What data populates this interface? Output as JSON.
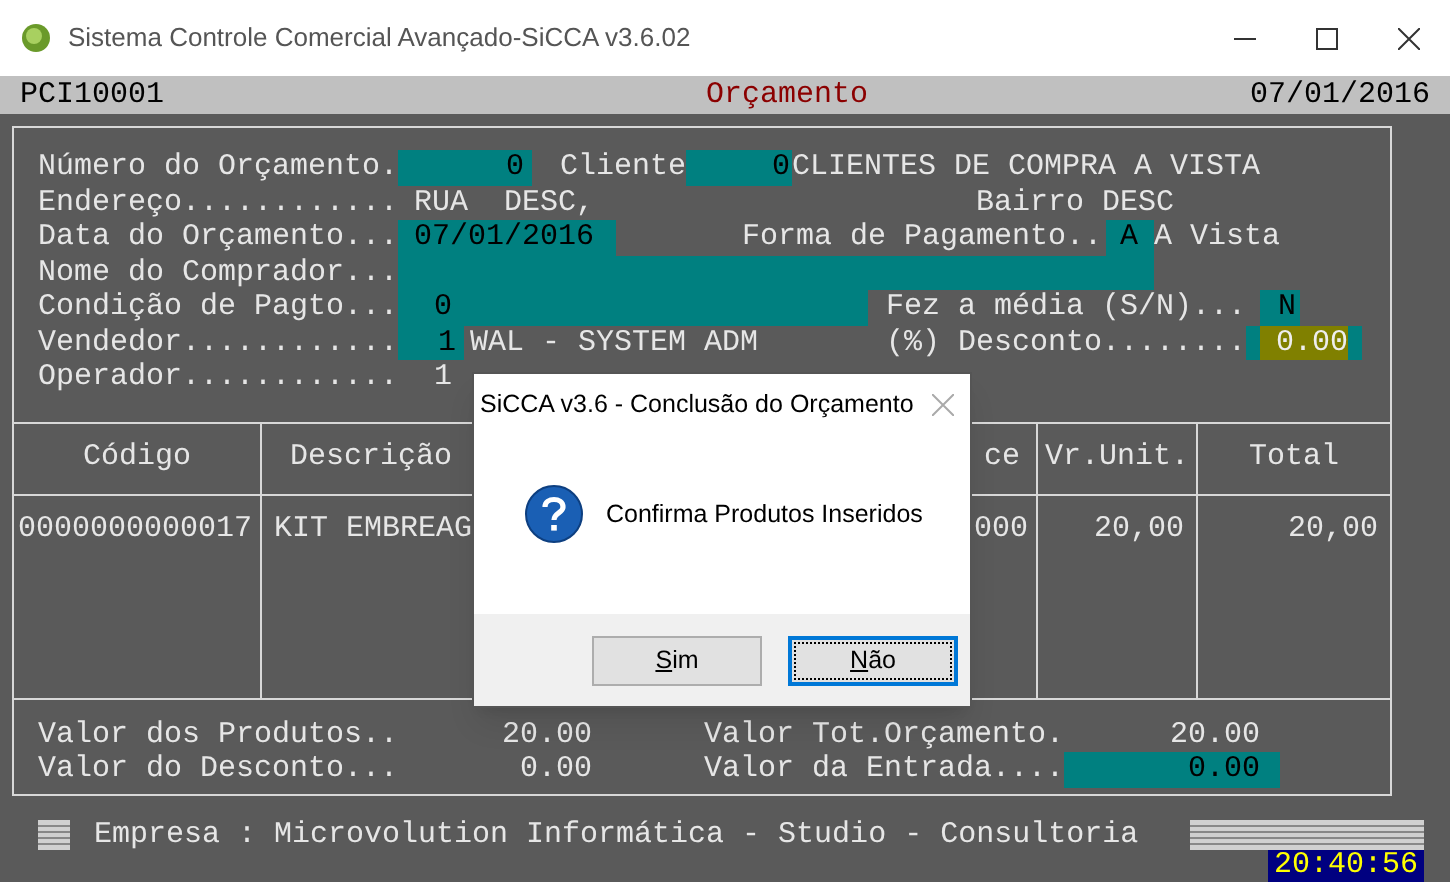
{
  "window": {
    "title": "Sistema Controle Comercial Avançado-SiCCA v3.6.02"
  },
  "header": {
    "code": "PCI10001",
    "title": "Orçamento",
    "date": "07/01/2016"
  },
  "form": {
    "numero": {
      "label": "Número do Orçamento.",
      "value": "0"
    },
    "cliente": {
      "label": "Cliente",
      "value": "0",
      "name": "CLIENTES DE COMPRA A VISTA"
    },
    "endereco": {
      "label": "Endereço............",
      "value": "RUA  DESC,",
      "bairro": "Bairro DESC"
    },
    "data": {
      "label": "Data do Orçamento...",
      "value": "07/01/2016"
    },
    "forma_pagamento": {
      "label": "Forma de Pagamento..",
      "code": "A",
      "name": "A Vista"
    },
    "comprador": {
      "label": "Nome do Comprador..."
    },
    "condicao": {
      "label": "Condição de Pagto...",
      "value": "0"
    },
    "fez_media": {
      "label": "Fez a média (S/N)...",
      "value": "N"
    },
    "vendedor": {
      "label": "Vendedor............",
      "value": "1",
      "name": "WAL - SYSTEM ADM"
    },
    "desconto": {
      "label": "(%) Desconto........",
      "value": "0.00"
    },
    "operador": {
      "label": "Operador............",
      "value": "1"
    }
  },
  "table": {
    "columns": [
      "Código",
      "Descrição",
      "ce",
      "Vr.Unit.",
      "Total"
    ],
    "rows": [
      [
        "0000000000017",
        "KIT EMBREAG",
        "000",
        "20,00",
        "20,00"
      ]
    ]
  },
  "totals": [
    {
      "label": "Valor dos Produtos..",
      "value": "20.00"
    },
    {
      "label": "Valor Tot.Orçamento.",
      "value": "20.00"
    },
    {
      "label": "Valor do Desconto...",
      "value": "0.00"
    },
    {
      "label": "Valor da Entrada....",
      "value": "0.00"
    }
  ],
  "footer": {
    "company": "Empresa : Microvolution Informática - Studio - Consultoria",
    "clock": "20:40:56"
  },
  "dialog": {
    "title": "SiCCA v3.6 - Conclusão do Orçamento",
    "message": "Confirma Produtos Inseridos",
    "buttons": [
      {
        "label": "Sim",
        "selected": false
      },
      {
        "label": "Não",
        "selected": true
      }
    ]
  }
}
